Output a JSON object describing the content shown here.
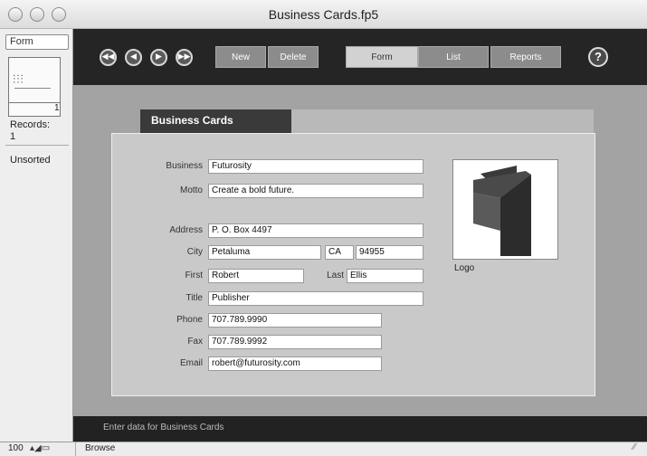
{
  "window": {
    "title": "Business Cards.fp5"
  },
  "status_area": {
    "layout": "Form",
    "record_number": "1",
    "records_label": "Records:",
    "records_count": "1",
    "sort_status": "Unsorted"
  },
  "toolbar": {
    "nav_buttons": [
      {
        "name": "first",
        "glyph": "◀◀"
      },
      {
        "name": "previous",
        "glyph": "◀"
      },
      {
        "name": "next",
        "glyph": "▶"
      },
      {
        "name": "last",
        "glyph": "▶▶"
      }
    ],
    "new_label": "New",
    "delete_label": "Delete",
    "form_label": "Form",
    "list_label": "List",
    "reports_label": "Reports",
    "help_label": "?"
  },
  "layout": {
    "tab_title": "Business Cards",
    "fields": {
      "business": {
        "label": "Business",
        "value": "Futurosity"
      },
      "motto": {
        "label": "Motto",
        "value": "Create a bold future."
      },
      "address": {
        "label": "Address",
        "value": "P. O. Box 4497"
      },
      "city": {
        "label": "City",
        "value": "Petaluma"
      },
      "state": {
        "value": "CA"
      },
      "zip": {
        "value": "94955"
      },
      "first": {
        "label": "First",
        "value": "Robert"
      },
      "last": {
        "label": "Last",
        "value": "Ellis"
      },
      "title": {
        "label": "Title",
        "value": "Publisher"
      },
      "phone": {
        "label": "Phone",
        "value": "707.789.9990"
      },
      "fax": {
        "label": "Fax",
        "value": "707.789.9992"
      },
      "email": {
        "label": "Email",
        "value": "robert@futurosity.com"
      }
    },
    "logo_label": "Logo"
  },
  "footer": {
    "text": "Enter data for Business Cards"
  },
  "bottom_bar": {
    "zoom": "100",
    "mode": "Browse"
  },
  "colors": {
    "toolbar": "#252525",
    "content": "#a3a3a3",
    "panel": "#c9c9c9",
    "button": "#8c8c8c"
  }
}
